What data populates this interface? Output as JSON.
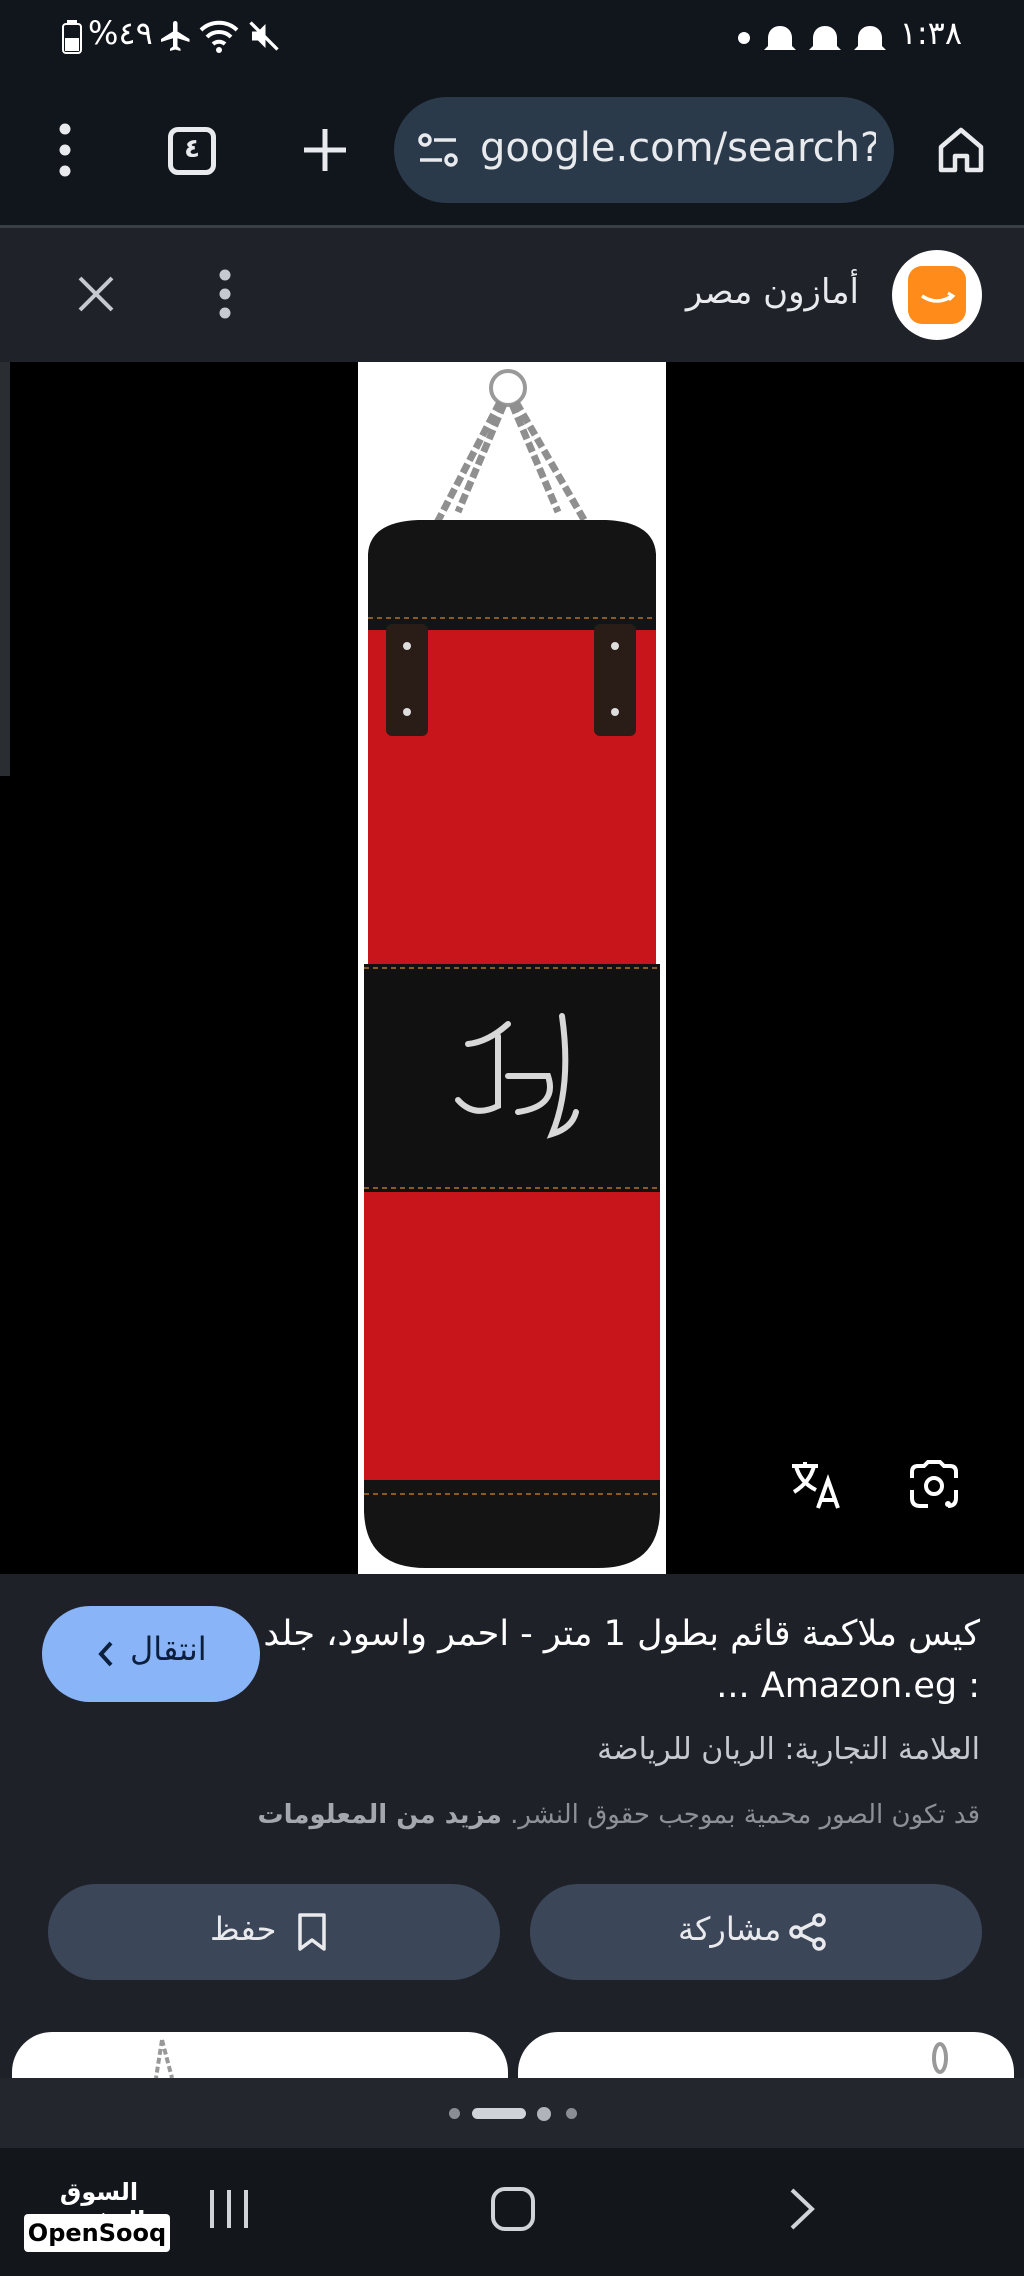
{
  "status_bar": {
    "time": "١:٣٨",
    "battery": "%٤٩"
  },
  "browser": {
    "url": "google.com/search?q",
    "tab_count": "٤"
  },
  "source": {
    "name": "أمازون مصر"
  },
  "result": {
    "title": "كيس ملاكمة قائم بطول 1 متر - احمر واسود، جلد : Amazon.eg ...",
    "brand": "العلامة التجارية: الريان للرياضة",
    "copyright_text": "قد تكون الصور محمية بموجب حقوق النشر.",
    "more_info_link": "مزيد من المعلومات",
    "visit_label": "انتقال",
    "share_label": "مشاركة",
    "save_label": "حفظ"
  },
  "watermark": {
    "arabic": "السوق المفتوح",
    "english": "OpenSooq"
  },
  "colors": {
    "accent_button": "#8ab4f8",
    "pill_button": "#3c4659",
    "amazon_orange": "#ff8c1a",
    "bag_red": "#c8151b"
  },
  "icons": [
    "menu-dots-icon",
    "tab-switcher-icon",
    "plus-icon",
    "site-settings-icon",
    "home-icon",
    "close-icon",
    "translate-icon",
    "lens-icon",
    "share-icon",
    "bookmark-icon",
    "chevron-left-icon",
    "recent-apps-icon",
    "home-nav-icon",
    "back-nav-icon"
  ]
}
